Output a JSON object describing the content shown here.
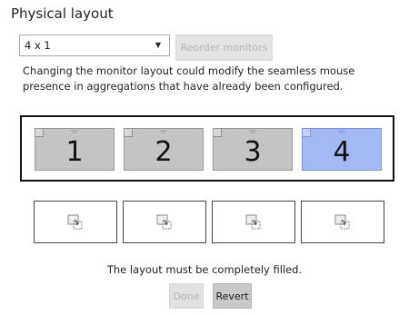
{
  "header": {
    "title": "Physical layout"
  },
  "layout_select": {
    "value": "4 x 1",
    "icon": "chevron-down-icon"
  },
  "reorder_button": {
    "label": "Reorder monitors",
    "enabled": false
  },
  "warning_text": "Changing the monitor layout could modify the seamless mouse presence in aggregations that have already been configured.",
  "monitors": [
    {
      "label": "1",
      "selected": false
    },
    {
      "label": "2",
      "selected": false
    },
    {
      "label": "3",
      "selected": false
    },
    {
      "label": "4",
      "selected": true
    }
  ],
  "layout_slots": [
    {
      "icon": "drop-monitor-icon"
    },
    {
      "icon": "drop-monitor-icon"
    },
    {
      "icon": "drop-monitor-icon"
    },
    {
      "icon": "drop-monitor-icon"
    }
  ],
  "status_message": "The layout must be completely filled.",
  "actions": {
    "done_label": "Done",
    "revert_label": "Revert"
  },
  "colors": {
    "monitor_fill": "#c4c4c4",
    "monitor_selected_fill": "#a3b9f6",
    "disabled_text": "#b5b5b5"
  }
}
